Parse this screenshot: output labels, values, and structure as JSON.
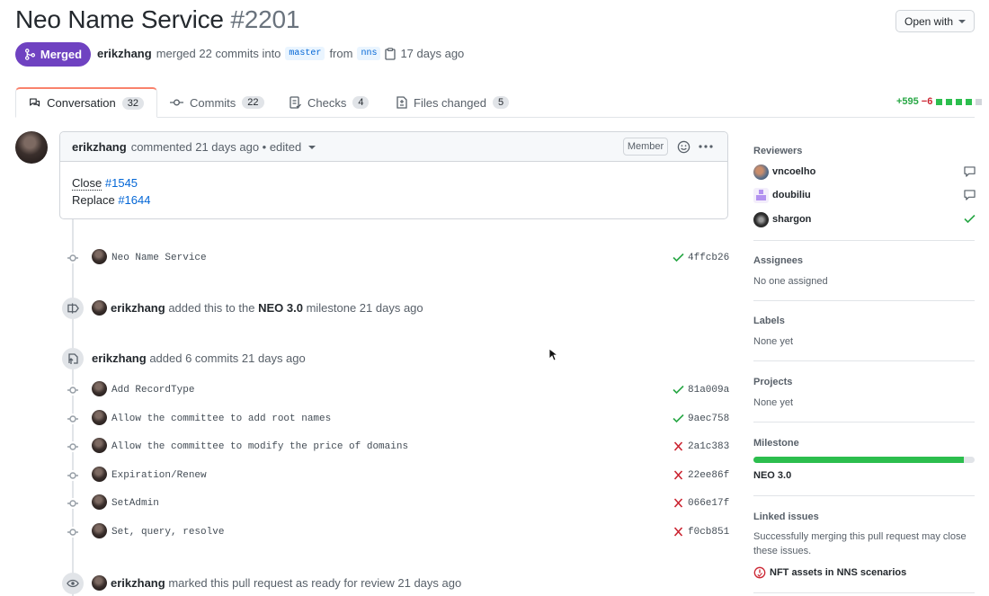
{
  "pr": {
    "title": "Neo Name Service",
    "number": "#2201",
    "status": "Merged",
    "author": "erikzhang",
    "merge_text": "merged 22 commits into",
    "base_branch": "master",
    "from_text": "from",
    "head_branch": "nns",
    "age": "17 days ago",
    "open_with": "Open with"
  },
  "tabs": [
    {
      "label": "Conversation",
      "count": "32"
    },
    {
      "label": "Commits",
      "count": "22"
    },
    {
      "label": "Checks",
      "count": "4"
    },
    {
      "label": "Files changed",
      "count": "5"
    }
  ],
  "diffstat": {
    "additions": "+595",
    "deletions": "−6"
  },
  "comment": {
    "author": "erikzhang",
    "meta": "commented 21 days ago • edited",
    "badge": "Member",
    "line1_prefix": "Close",
    "line1_link": "#1545",
    "line2_prefix": "Replace",
    "line2_link": "#1644"
  },
  "first_commit": {
    "message": "Neo Name Service",
    "sha": "4ffcb26",
    "status": "success"
  },
  "milestone_event": {
    "actor": "erikzhang",
    "text": "added this to the",
    "milestone": "NEO 3.0",
    "suffix": "milestone 21 days ago"
  },
  "commits_event": {
    "actor": "erikzhang",
    "text": "added 6 commits 21 days ago"
  },
  "commits": [
    {
      "message": "Add RecordType",
      "sha": "81a009a",
      "status": "success"
    },
    {
      "message": "Allow the committee to add root names",
      "sha": "9aec758",
      "status": "success"
    },
    {
      "message": "Allow the committee to modify the price of domains",
      "sha": "2a1c383",
      "status": "failure"
    },
    {
      "message": "Expiration/Renew",
      "sha": "22ee86f",
      "status": "failure"
    },
    {
      "message": "SetAdmin",
      "sha": "066e17f",
      "status": "failure"
    },
    {
      "message": "Set, query, resolve",
      "sha": "f0cb851",
      "status": "failure"
    }
  ],
  "ready_event": {
    "actor": "erikzhang",
    "text": "marked this pull request as ready for review 21 days ago"
  },
  "sidebar": {
    "reviewers_title": "Reviewers",
    "reviewers": [
      {
        "name": "vncoelho",
        "state": "commented"
      },
      {
        "name": "doubiliu",
        "state": "commented"
      },
      {
        "name": "shargon",
        "state": "approved"
      }
    ],
    "assignees_title": "Assignees",
    "assignees_value": "No one assigned",
    "labels_title": "Labels",
    "labels_value": "None yet",
    "projects_title": "Projects",
    "projects_value": "None yet",
    "milestone_title": "Milestone",
    "milestone_name": "NEO 3.0",
    "milestone_progress": 0.95,
    "linked_title": "Linked issues",
    "linked_desc_1": "Successfully merging this pull request may close",
    "linked_desc_2": "these issues.",
    "linked_issue": "NFT assets in NNS scenarios"
  },
  "colors": {
    "merged": "#6f42c1",
    "success": "#28a745",
    "failure": "#cb2431",
    "link": "#0366d6"
  }
}
